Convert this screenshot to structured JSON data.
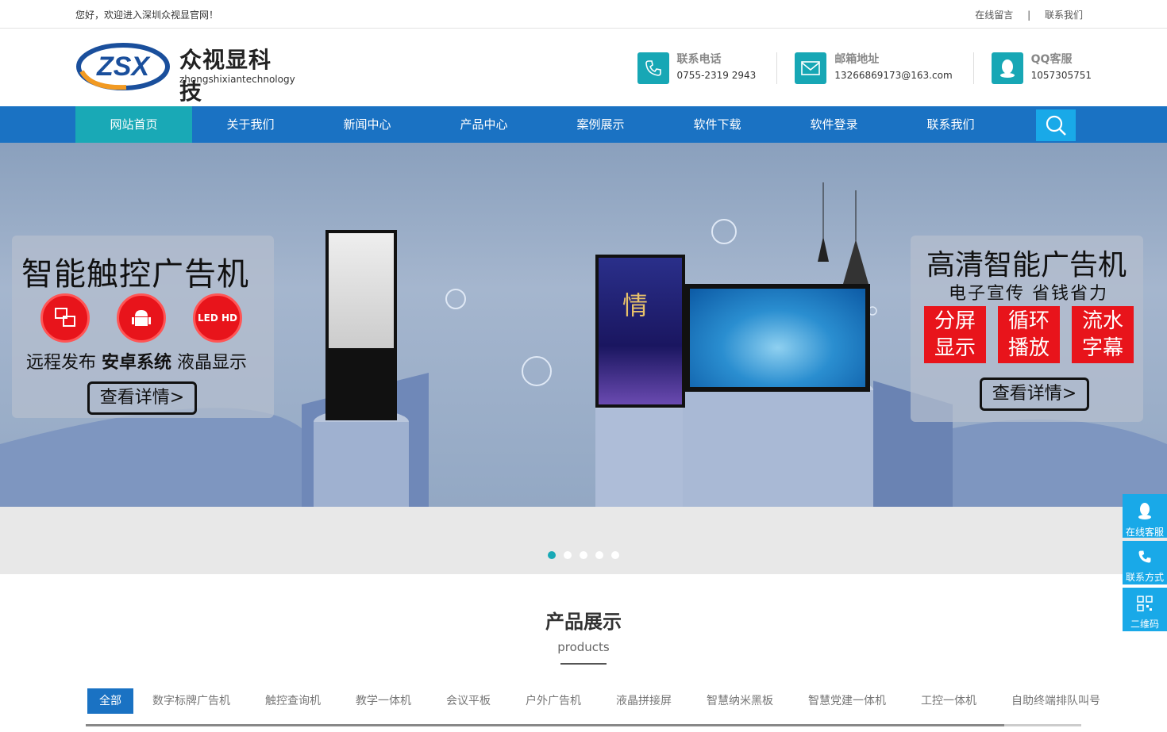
{
  "topbar": {
    "welcome": "您好，欢迎进入深圳众视显官网！",
    "link1": "在线留言",
    "sep": "|",
    "link2": "联系我们"
  },
  "logo": {
    "cn": "众视显科技",
    "en": "zhongshixiantechnology",
    "mark": "ZSX"
  },
  "contacts": [
    {
      "label": "联系电话",
      "value": "0755-2319 2943",
      "icon": "phone-icon"
    },
    {
      "label": "邮箱地址",
      "value": "13266869173@163.com",
      "icon": "mail-icon"
    },
    {
      "label": "QQ客服",
      "value": "1057305751",
      "icon": "qq-icon"
    }
  ],
  "nav": [
    "网站首页",
    "关于我们",
    "新闻中心",
    "产品中心",
    "案例展示",
    "软件下载",
    "软件登录",
    "联系我们"
  ],
  "banner": {
    "left_title": "智能触控广告机",
    "left_icon_text": "LED HD",
    "left_f1": "远程发布",
    "left_f2": "安卓系统",
    "left_f3": "液晶显示",
    "left_btn": "查看详情>",
    "right_title": "高清智能广告机",
    "right_sub": "电子宣传 省钱省力",
    "tiles": [
      [
        "分屏",
        "显示"
      ],
      [
        "循环",
        "播放"
      ],
      [
        "流水",
        "字幕"
      ]
    ],
    "right_btn": "查看详情>",
    "poster_char": "情"
  },
  "section": {
    "title": "产品展示",
    "sub": "products"
  },
  "tabs": [
    "全部",
    "数字标牌广告机",
    "触控查询机",
    "教学一体机",
    "会议平板",
    "户外广告机",
    "液晶拼接屏",
    "智慧纳米黑板",
    "智慧党建一体机",
    "工控一体机",
    "自助终端排队叫号"
  ],
  "side": [
    "在线客服",
    "联系方式",
    "二维码"
  ],
  "colors": {
    "nav": "#1a72c3",
    "accent": "#19a9b6",
    "red": "#e8141b"
  }
}
